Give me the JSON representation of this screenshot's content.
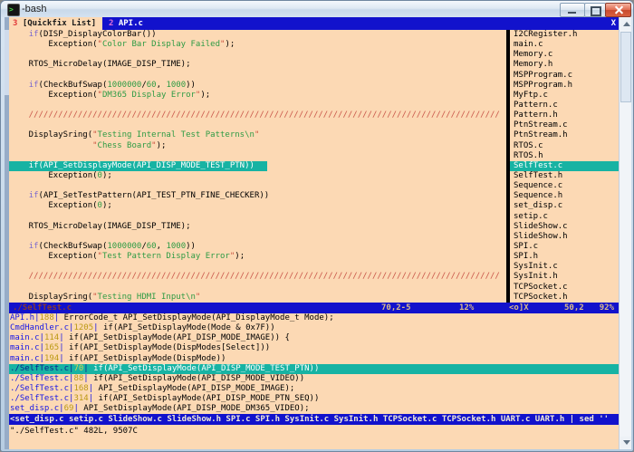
{
  "window": {
    "title": "-bash",
    "icons": {
      "terminal": "dark square with green prompt",
      "minimize": "dash",
      "restore": "square",
      "close": "cross",
      "scroll_up": "triangle-up",
      "scroll_down": "triangle-down"
    }
  },
  "tabline": {
    "inactive_tab": {
      "number": "3",
      "label": " [Quickfix List] "
    },
    "active_tab": {
      "number": "2",
      "label": " API.c"
    },
    "close_label": "X"
  },
  "editor": {
    "lines": [
      [
        [
          "    ",
          "p"
        ],
        [
          "if",
          "k"
        ],
        [
          "(DISP_DisplayColorBar())",
          "p"
        ]
      ],
      [
        [
          "        Exception(",
          "p"
        ],
        [
          "\"",
          "q"
        ],
        [
          "Color Bar Display Failed",
          "s"
        ],
        [
          "\"",
          "q"
        ],
        [
          ");",
          "p"
        ]
      ],
      [],
      [
        [
          "    RTOS_MicroDelay(IMAGE_DISP_TIME);",
          "p"
        ]
      ],
      [],
      [
        [
          "    ",
          "p"
        ],
        [
          "if",
          "k"
        ],
        [
          "(CheckBufSwap(",
          "p"
        ],
        [
          "1000000",
          "n"
        ],
        [
          "/",
          "p"
        ],
        [
          "60",
          "n"
        ],
        [
          ", ",
          "p"
        ],
        [
          "1000",
          "n"
        ],
        [
          "))",
          "p"
        ]
      ],
      [
        [
          "        Exception(",
          "p"
        ],
        [
          "\"",
          "q"
        ],
        [
          "DM365 Display Error",
          "s"
        ],
        [
          "\"",
          "q"
        ],
        [
          ");",
          "p"
        ]
      ],
      [],
      [
        [
          "    ////////////////////////////////////////////////////////////////////////////////////////////////",
          "c"
        ]
      ],
      [],
      [
        [
          "    DisplaySring(",
          "p"
        ],
        [
          "\"",
          "q"
        ],
        [
          "Testing Internal Test Patterns\\n",
          "s"
        ],
        [
          "\"",
          "q"
        ]
      ],
      [
        [
          "                 ",
          "p"
        ],
        [
          "\"",
          "q"
        ],
        [
          "Chess Board",
          "s"
        ],
        [
          "\"",
          "q"
        ],
        [
          ");",
          "p"
        ]
      ],
      [],
      [
        [
          "    if(API_SetDisplayMode(API_DISP_MODE_TEST_PTN))",
          "h"
        ]
      ],
      [
        [
          "        Exception(",
          "p"
        ],
        [
          "0",
          "n"
        ],
        [
          ");",
          "p"
        ]
      ],
      [],
      [
        [
          "    ",
          "p"
        ],
        [
          "if",
          "k"
        ],
        [
          "(API_SetTestPattern(API_TEST_PTN_FINE_CHECKER))",
          "p"
        ]
      ],
      [
        [
          "        Exception(",
          "p"
        ],
        [
          "0",
          "n"
        ],
        [
          ");",
          "p"
        ]
      ],
      [],
      [
        [
          "    RTOS_MicroDelay(IMAGE_DISP_TIME);",
          "p"
        ]
      ],
      [],
      [
        [
          "    ",
          "p"
        ],
        [
          "if",
          "k"
        ],
        [
          "(CheckBufSwap(",
          "p"
        ],
        [
          "1000000",
          "n"
        ],
        [
          "/",
          "p"
        ],
        [
          "60",
          "n"
        ],
        [
          ", ",
          "p"
        ],
        [
          "1000",
          "n"
        ],
        [
          "))",
          "p"
        ]
      ],
      [
        [
          "        Exception(",
          "p"
        ],
        [
          "\"",
          "q"
        ],
        [
          "Test Pattern Display Error",
          "s"
        ],
        [
          "\"",
          "q"
        ],
        [
          ");",
          "p"
        ]
      ],
      [],
      [
        [
          "    ////////////////////////////////////////////////////////////////////////////////////////////////",
          "c"
        ]
      ],
      [],
      [
        [
          "    DisplaySring(",
          "p"
        ],
        [
          "\"",
          "q"
        ],
        [
          "Testing HDMI Input\\n",
          "s"
        ],
        [
          "\"",
          "q"
        ]
      ]
    ]
  },
  "file_panel": {
    "selected_index": 13,
    "files": [
      "I2CRegister.h",
      "main.c",
      "Memory.c",
      "Memory.h",
      "MSPProgram.c",
      "MSPProgram.h",
      "MyFtp.c",
      "Pattern.c",
      "Pattern.h",
      "PtnStream.c",
      "PtnStream.h",
      "RTOS.c",
      "RTOS.h",
      "SelfTest.c",
      "SelfTest.h",
      "Sequence.c",
      "Sequence.h",
      "set_disp.c",
      "setip.c",
      "SlideShow.c",
      "SlideShow.h",
      "SPI.c",
      "SPI.h",
      "SysInit.c",
      "SysInit.h",
      "TCPSocket.c",
      "TCPSocket.h"
    ]
  },
  "statusline": {
    "left_file": "./SelfTest.c",
    "left_pos": "70,2-5",
    "left_pct": "12%",
    "right_name": "<o]X",
    "right_pos": "50,2",
    "right_pct": "92%"
  },
  "quickfix": {
    "rows": [
      {
        "file": "API.h",
        "line": "188",
        "text": " ErrorCode_t API_SetDisplayMode(API_DisplayMode_t Mode);",
        "selected": false
      },
      {
        "file": "CmdHandler.c",
        "line": "1205",
        "text": " if(API_SetDisplayMode(Mode & 0x7F))",
        "selected": false
      },
      {
        "file": "main.c",
        "line": "114",
        "text": " if(API_SetDisplayMode(API_DISP_MODE_IMAGE)) {",
        "selected": false
      },
      {
        "file": "main.c",
        "line": "165",
        "text": " if(API_SetDisplayMode(DispModes[Select]))",
        "selected": false
      },
      {
        "file": "main.c",
        "line": "194",
        "text": " if(API_SetDisplayMode(DispMode))",
        "selected": false
      },
      {
        "file": "./SelfTest.c",
        "line": "70",
        "text": " if(API_SetDisplayMode(API_DISP_MODE_TEST_PTN))",
        "selected": true
      },
      {
        "file": "./SelfTest.c",
        "line": "88",
        "text": " if(API_SetDisplayMode(API_DISP_MODE_VIDEO))",
        "selected": false
      },
      {
        "file": "./SelfTest.c",
        "line": "168",
        "text": " API_SetDisplayMode(API_DISP_MODE_IMAGE);",
        "selected": false
      },
      {
        "file": "./SelfTest.c",
        "line": "314",
        "text": " if(API_SetDisplayMode(API_DISP_MODE_PTN_SEQ))",
        "selected": false
      },
      {
        "file": "set_disp.c",
        "line": "69",
        "text": " API_SetDisplayMode(API_DISP_MODE_DM365_VIDEO);",
        "selected": false
      }
    ]
  },
  "command_bar": {
    "text": "<set_disp.c setip.c SlideShow.c SlideShow.h SPI.c SPI.h SysInit.c SysInit.h TCPSocket.c TCPSocket.h UART.c UART.h | sed ''"
  },
  "message_line": {
    "text": "\"./SelfTest.c\" 482L, 9507C"
  },
  "colors": {
    "terminal_bg": "#fcd9b4",
    "statusline_blue": "#1212cc",
    "selection_teal": "#17b3a3",
    "string_green": "#2e9b44",
    "comment_red": "#c9574a",
    "keyword_purple": "#7a68cf",
    "quickfix_file_blue": "#1616e6",
    "quickfix_linenum_yellow": "#bb9912",
    "status_text_tan": "#d9bb8a",
    "status_file_maroon": "#8b3a2e"
  }
}
